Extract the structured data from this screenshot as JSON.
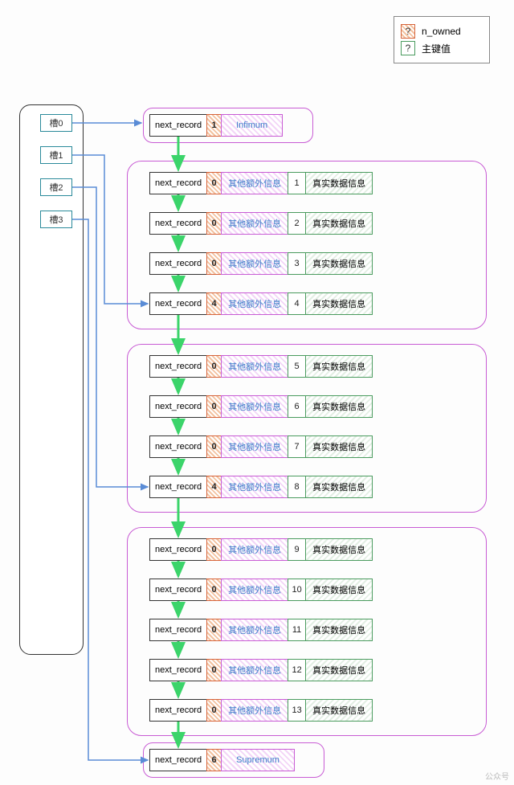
{
  "legend": {
    "n_owned_label": "n_owned",
    "pk_label": "主键值",
    "q": "?"
  },
  "slots": [
    {
      "label": "槽0"
    },
    {
      "label": "槽1"
    },
    {
      "label": "槽2"
    },
    {
      "label": "槽3"
    }
  ],
  "labels": {
    "next_record": "next_record",
    "extra_info": "其他额外信息",
    "real_data": "真实数据信息",
    "infimum": "Infimum",
    "supremum": "Supremum"
  },
  "infimum": {
    "n_owned": "1"
  },
  "supremum": {
    "n_owned": "6"
  },
  "groups": [
    {
      "records": [
        {
          "n_owned": "0",
          "pk": "1"
        },
        {
          "n_owned": "0",
          "pk": "2"
        },
        {
          "n_owned": "0",
          "pk": "3"
        },
        {
          "n_owned": "4",
          "pk": "4"
        }
      ]
    },
    {
      "records": [
        {
          "n_owned": "0",
          "pk": "5"
        },
        {
          "n_owned": "0",
          "pk": "6"
        },
        {
          "n_owned": "0",
          "pk": "7"
        },
        {
          "n_owned": "4",
          "pk": "8"
        }
      ]
    },
    {
      "records": [
        {
          "n_owned": "0",
          "pk": "9"
        },
        {
          "n_owned": "0",
          "pk": "10"
        },
        {
          "n_owned": "0",
          "pk": "11"
        },
        {
          "n_owned": "0",
          "pk": "12"
        },
        {
          "n_owned": "0",
          "pk": "13"
        }
      ]
    }
  ],
  "watermark": "公众号"
}
